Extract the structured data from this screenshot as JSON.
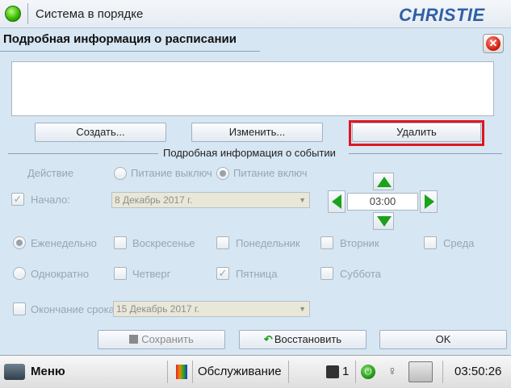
{
  "status_bar": {
    "status_text": "Система в порядке",
    "brand": "CHRISTIE"
  },
  "dialog": {
    "title": "Подробная информация о расписании",
    "buttons": {
      "create": "Создать...",
      "edit": "Изменить...",
      "delete": "Удалить"
    },
    "event_section_label": "Подробная информация о событии",
    "action_label": "Действие",
    "power_off": "Питание выключ",
    "power_on": "Питание включ",
    "start_label": "Начало:",
    "start_date": "8 Декабрь 2017 г.",
    "time": "03:00",
    "weekly": "Еженедельно",
    "once": "Однократно",
    "days": {
      "sun": "Воскресенье",
      "mon": "Понедельник",
      "tue": "Вторник",
      "wed": "Среда",
      "thu": "Четверг",
      "fri": "Пятница",
      "sat": "Суббота"
    },
    "end_label": "Окончание срока",
    "end_date": "15 Декабрь 2017 г.",
    "save": "Сохранить",
    "restore": "Восстановить",
    "ok": "OK"
  },
  "taskbar": {
    "menu": "Меню",
    "service": "Обслуживание",
    "count": "1",
    "clock": "03:50:26"
  },
  "colors": {
    "accent_green": "#1aa21a",
    "highlight_red": "#e0161f",
    "brand_blue": "#2f5fa8"
  }
}
